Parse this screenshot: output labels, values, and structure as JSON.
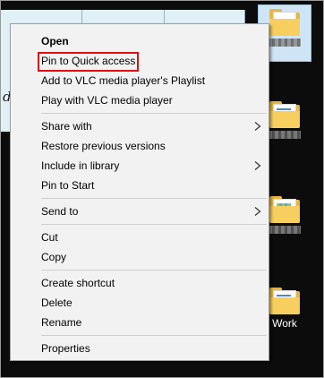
{
  "menu": {
    "items": [
      {
        "label": "Open"
      },
      {
        "label": "Pin to Quick access"
      },
      {
        "label": "Add to VLC media player's Playlist"
      },
      {
        "label": "Play with VLC media player"
      },
      {
        "label": "Share with"
      },
      {
        "label": "Restore previous versions"
      },
      {
        "label": "Include in library"
      },
      {
        "label": "Pin to Start"
      },
      {
        "label": "Send to"
      },
      {
        "label": "Cut"
      },
      {
        "label": "Copy"
      },
      {
        "label": "Create shortcut"
      },
      {
        "label": "Delete"
      },
      {
        "label": "Rename"
      },
      {
        "label": "Properties"
      }
    ],
    "highlight_color": "#d2141a"
  },
  "desktop": {
    "icons": [
      {
        "label": ""
      },
      {
        "label": ""
      },
      {
        "label": ""
      },
      {
        "label": ""
      },
      {
        "label": "Work"
      }
    ]
  },
  "icon_names": {
    "folder": "folder-icon",
    "submenu": "chevron-right-icon"
  }
}
